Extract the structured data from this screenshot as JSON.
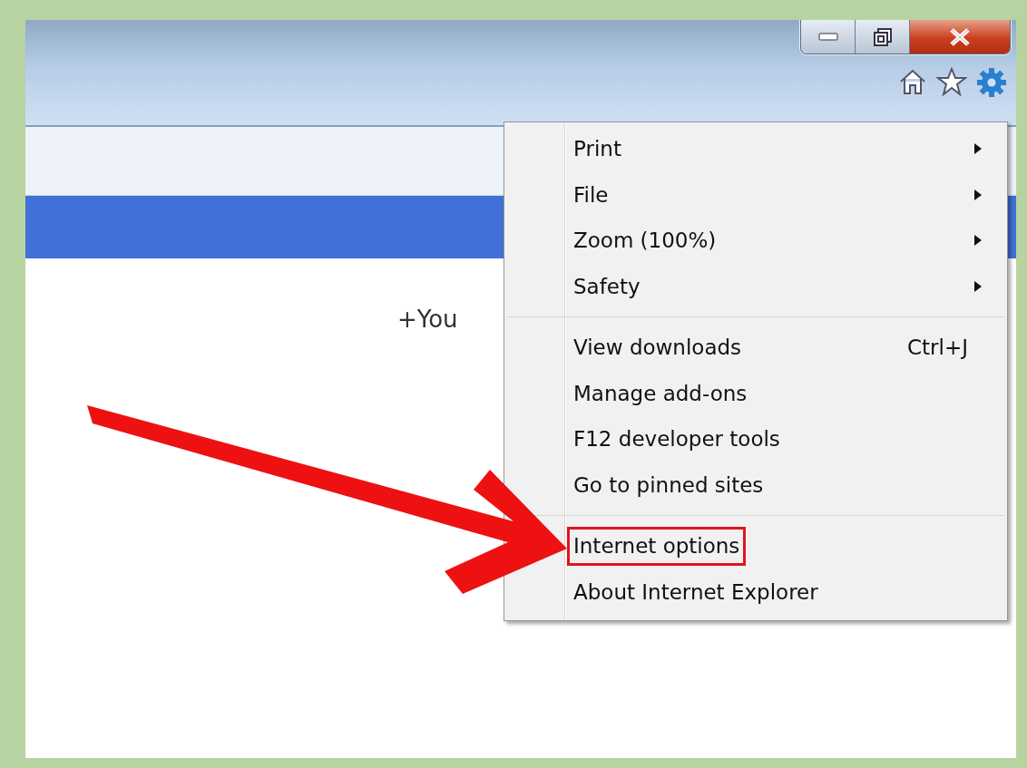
{
  "page": {
    "links": [
      "+You"
    ]
  },
  "menu": {
    "groups": [
      {
        "items": [
          {
            "label": "Print",
            "kind": "submenu",
            "highlighted": false
          },
          {
            "label": "File",
            "kind": "submenu",
            "highlighted": false
          },
          {
            "label": "Zoom (100%)",
            "kind": "submenu",
            "highlighted": false
          },
          {
            "label": "Safety",
            "kind": "submenu",
            "highlighted": false
          }
        ]
      },
      {
        "items": [
          {
            "label": "View downloads",
            "kind": "shortcut",
            "shortcut": "Ctrl+J",
            "highlighted": false
          },
          {
            "label": "Manage add-ons",
            "kind": "plain",
            "highlighted": false
          },
          {
            "label": "F12 developer tools",
            "kind": "plain",
            "highlighted": false
          },
          {
            "label": "Go to pinned sites",
            "kind": "plain",
            "highlighted": false
          }
        ]
      },
      {
        "items": [
          {
            "label": "Internet options",
            "kind": "plain",
            "highlighted": true
          },
          {
            "label": "About Internet Explorer",
            "kind": "plain",
            "highlighted": false
          }
        ]
      }
    ]
  }
}
